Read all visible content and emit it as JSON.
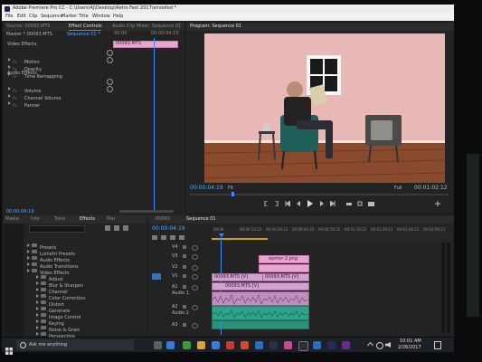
{
  "window": {
    "title": "Adobe Premiere Pro CC - C:\\Users\\AJ\\Desktop\\Retro Fest 2017\\smoofed *"
  },
  "menu": {
    "items": [
      "File",
      "Edit",
      "Clip",
      "Sequence",
      "Marker",
      "Title",
      "Window",
      "Help"
    ]
  },
  "source_panel": {
    "tab_label": "Source: 00093.MTS",
    "effect_controls_tab": "Effect Controls",
    "audio_mixer_tab": "Audio Clip Mixer: Sequence 01",
    "master_label": "Master * 00093.MTS",
    "sequence_label": "Sequence 01 *",
    "time_start": "00:00",
    "time_marker": "00:00:04:23",
    "clip_label": "00093.MTS",
    "video_effects_label": "Video Effects",
    "motion": "Motion",
    "opacity": "Opacity",
    "time_remapping": "Time Remapping",
    "audio_effects_label": "Audio Effects",
    "volume": "Volume",
    "channel_volume": "Channel Volume",
    "panner": "Panner",
    "timecode": "00:00:04:19"
  },
  "program_panel": {
    "tab_label": "Program: Sequence 01",
    "timecode": "00:00:04:19",
    "fit": "Fit",
    "full": "Full",
    "duration": "00:01:02:12"
  },
  "effects_panel": {
    "tabs": [
      "Media",
      "Info",
      "Tools",
      "Effects",
      "Mar"
    ],
    "search_placeholder": "",
    "items": [
      {
        "label": "Presets",
        "indent": 0
      },
      {
        "label": "Lumetri Presets",
        "indent": 0
      },
      {
        "label": "Audio Effects",
        "indent": 0
      },
      {
        "label": "Audio Transitions",
        "indent": 0
      },
      {
        "label": "Video Effects",
        "indent": 0
      },
      {
        "label": "Adjust",
        "indent": 1
      },
      {
        "label": "Blur & Sharpen",
        "indent": 1
      },
      {
        "label": "Channel",
        "indent": 1
      },
      {
        "label": "Color Correction",
        "indent": 1
      },
      {
        "label": "Distort",
        "indent": 1
      },
      {
        "label": "Generate",
        "indent": 1
      },
      {
        "label": "Image Control",
        "indent": 1
      },
      {
        "label": "Keying",
        "indent": 1
      },
      {
        "label": "Noise & Grain",
        "indent": 1
      },
      {
        "label": "Perspective",
        "indent": 1
      },
      {
        "label": "Stylize",
        "indent": 1
      }
    ]
  },
  "timeline": {
    "tabs": [
      "00093",
      "Sequence 01"
    ],
    "timecode": "00:00:04:19",
    "ruler": [
      "00:00",
      "00:00:14:23",
      "00:00:29:23",
      "00:00:44:22",
      "00:00:59:22",
      "00:01:14:22",
      "00:01:29:21",
      "00:01:44:21",
      "00:01:59:21"
    ],
    "tracks": [
      "V4",
      "V3",
      "V2",
      "V1",
      "A1",
      "A2",
      "A3"
    ],
    "track_names": {
      "a1": "Audio 1",
      "a2": "Audio 2"
    },
    "clips": {
      "title_clip": "epmer 2.png",
      "v2_clip": "00093.MTS [V]",
      "v1_clip": "00093.MTS [V]",
      "v1_clip_b": "00093.MTS [V]"
    }
  },
  "taskbar": {
    "search_placeholder": "Ask me anything",
    "time": "10:01 AM",
    "date": "2/26/2017"
  }
}
